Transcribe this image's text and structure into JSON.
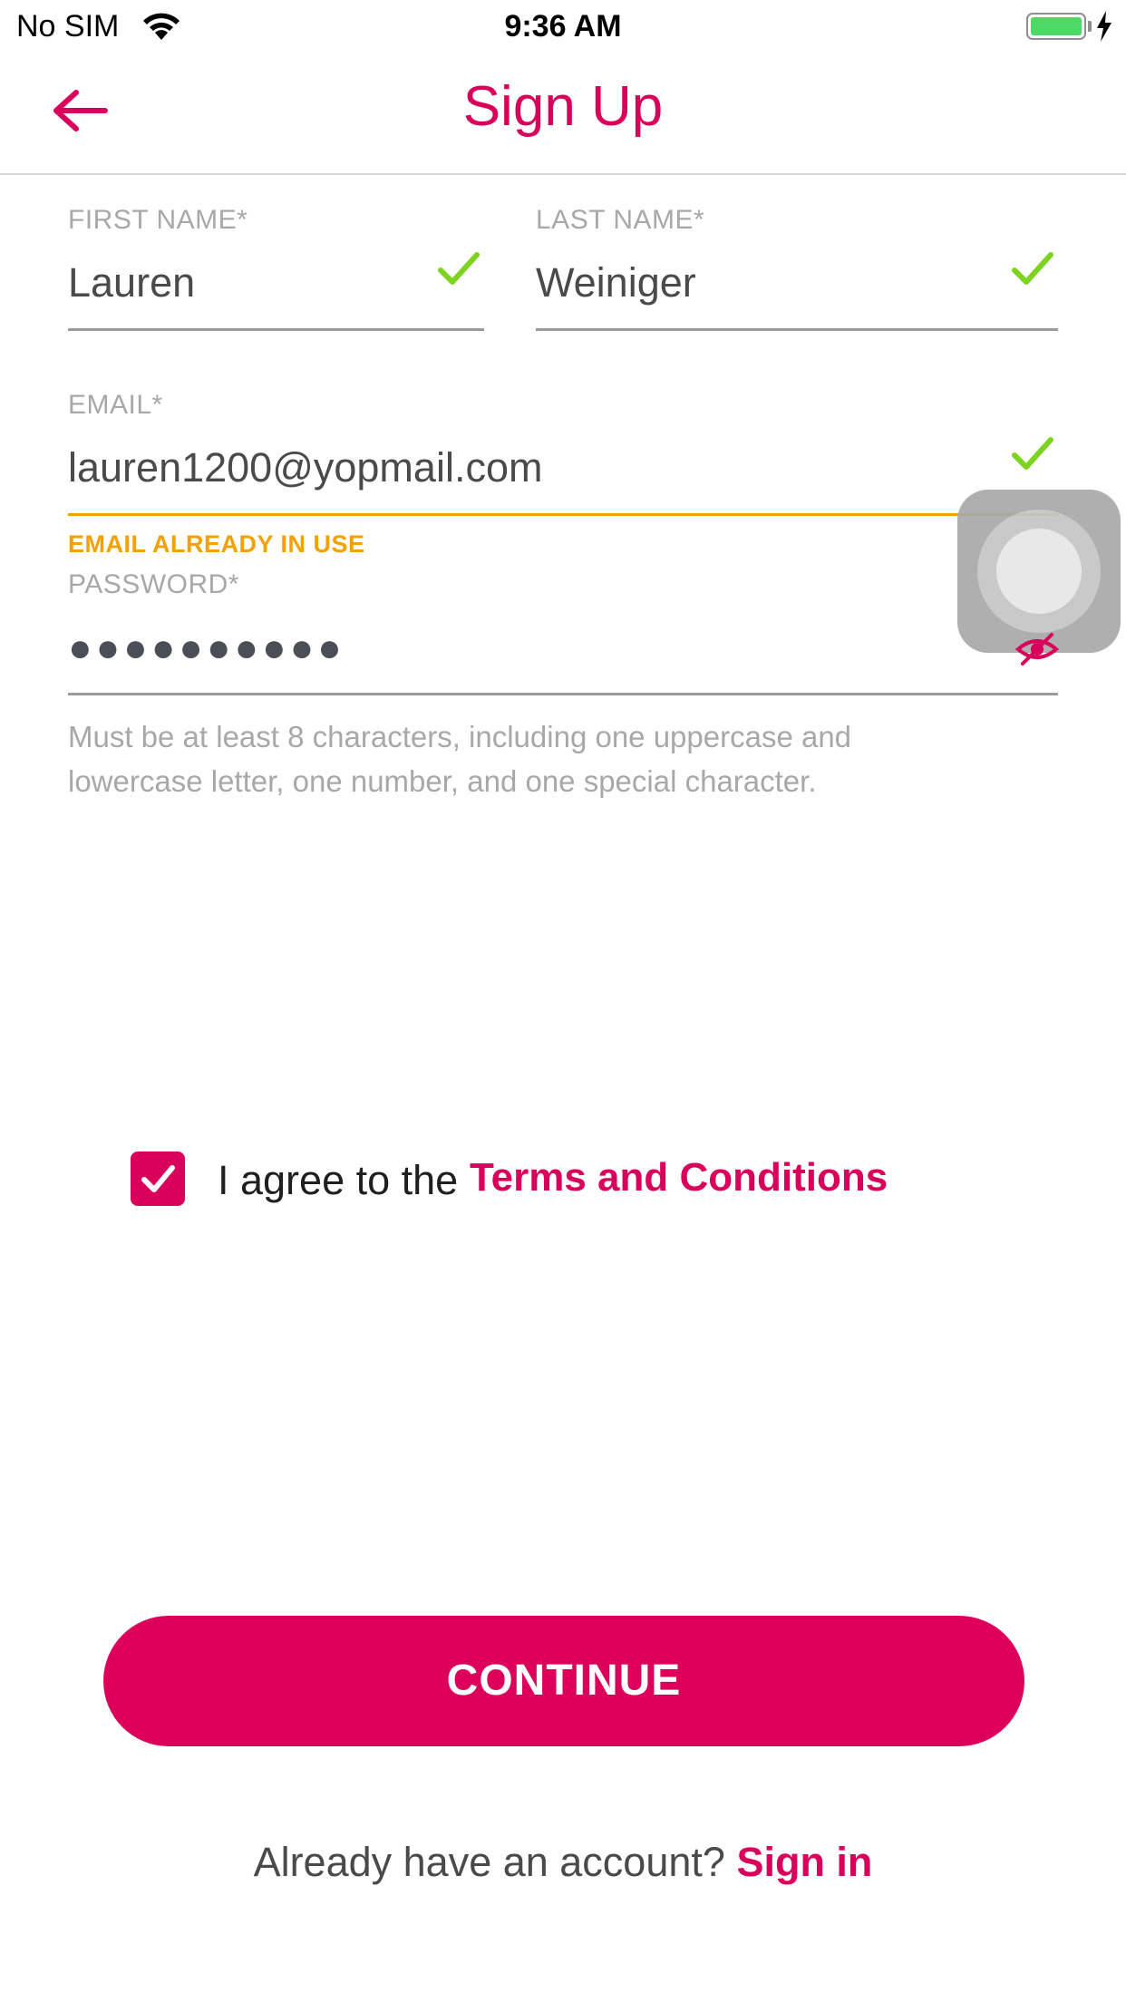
{
  "status_bar": {
    "carrier": "No SIM",
    "time": "9:36 AM",
    "wifi_icon": "wifi-icon",
    "battery_icon": "battery-icon",
    "charging_icon": "bolt-icon"
  },
  "header": {
    "back_icon": "arrow-left-icon",
    "title": "Sign Up"
  },
  "form": {
    "first_name": {
      "label": "FIRST NAME*",
      "value": "Lauren",
      "valid": true
    },
    "last_name": {
      "label": "LAST NAME*",
      "value": "Weiniger",
      "valid": true
    },
    "email": {
      "label": "EMAIL*",
      "value": "lauren1200@yopmail.com",
      "valid": true,
      "error": "EMAIL ALREADY IN USE"
    },
    "password": {
      "label": "PASSWORD*",
      "value": "●●●●●●●●●●",
      "visibility_icon": "eye-off-icon",
      "hint": "Must be at least 8 characters, including one uppercase and lowercase letter, one number, and one special character."
    }
  },
  "agree": {
    "checked": true,
    "text": "I agree to the",
    "link": "Terms and Conditions"
  },
  "continue_button": "CONTINUE",
  "signin": {
    "text": "Already have an account?",
    "link": "Sign in"
  },
  "colors": {
    "brand": "#d8005a",
    "success": "#7ed321",
    "warning": "#f2a100"
  }
}
